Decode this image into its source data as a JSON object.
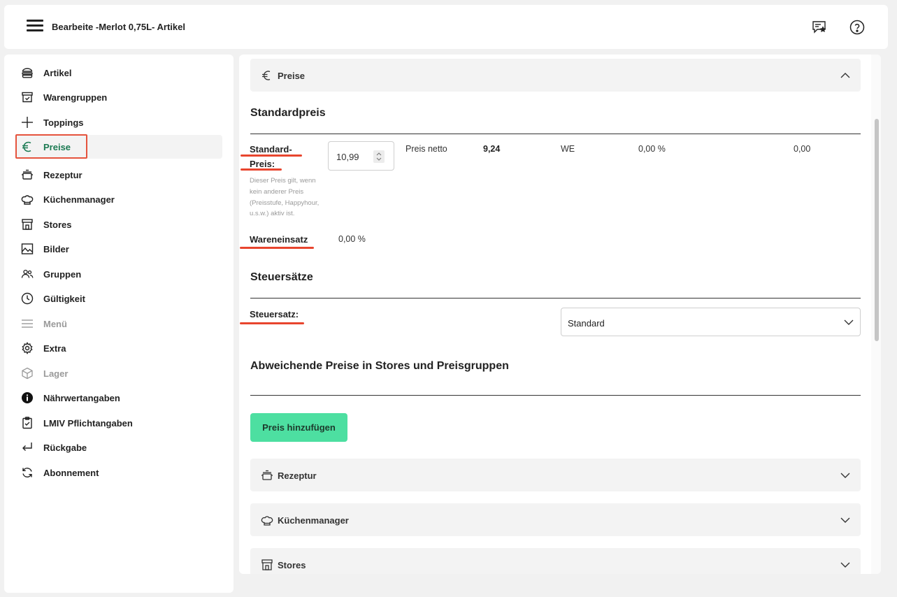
{
  "topbar": {
    "title": "Bearbeite -Merlot 0,75L- Artikel",
    "icons": [
      "menu-icon",
      "feedback-star-icon",
      "help-circle-icon"
    ]
  },
  "sidebar": {
    "items": [
      {
        "label": "Artikel",
        "icon": "burger-stack-icon"
      },
      {
        "label": "Warengruppen",
        "icon": "box-check-icon"
      },
      {
        "label": "Toppings",
        "icon": "plus-icon"
      },
      {
        "label": "Preise",
        "icon": "euro-icon",
        "active": true
      },
      {
        "label": "Rezeptur",
        "icon": "pot-icon"
      },
      {
        "label": "Küchenmanager",
        "icon": "chef-hat-icon"
      },
      {
        "label": "Stores",
        "icon": "store-icon"
      },
      {
        "label": "Bilder",
        "icon": "image-icon"
      },
      {
        "label": "Gruppen",
        "icon": "users-icon"
      },
      {
        "label": "Gültigkeit",
        "icon": "clock-icon"
      },
      {
        "label": "Menü",
        "icon": "list-icon",
        "disabled": true
      },
      {
        "label": "Extra",
        "icon": "gear-icon"
      },
      {
        "label": "Lager",
        "icon": "cube-icon",
        "disabled": true
      },
      {
        "label": "Nährwertangaben",
        "icon": "info-filled-icon"
      },
      {
        "label": "LMIV Pflichtangaben",
        "icon": "clipboard-check-icon"
      },
      {
        "label": "Rückgabe",
        "icon": "return-arrow-icon"
      },
      {
        "label": "Abonnement",
        "icon": "refresh-icon"
      }
    ]
  },
  "main": {
    "preise_section": {
      "label": "Preise"
    },
    "standardpreis": {
      "title": "Standardpreis",
      "label_line1": "Standard-",
      "label_line2": "Preis:",
      "hint": "Dieser Preis gilt, wenn kein anderer Preis (Preisstufe, Happyhour, u.s.w.) aktiv ist.",
      "value": "10,99",
      "preis_netto_label": "Preis netto",
      "preis_netto_value": "9,24",
      "we_label": "WE",
      "we_percent": "0,00 %",
      "we_value": "0,00",
      "wareneinsatz_label": "Wareneinsatz",
      "wareneinsatz_value": "0,00 %"
    },
    "steuersaetze": {
      "title": "Steuersätze",
      "label": "Steuersatz:",
      "selected": "Standard"
    },
    "abweichende": {
      "title": "Abweichende Preise in Stores und Preisgruppen",
      "add_button": "Preis hinzufügen"
    },
    "accordions": [
      {
        "label": "Rezeptur",
        "icon": "pot-icon"
      },
      {
        "label": "Küchenmanager",
        "icon": "chef-hat-icon"
      },
      {
        "label": "Stores",
        "icon": "store-icon"
      }
    ]
  },
  "colors": {
    "accent_green": "#4ddfa1",
    "active_text": "#1b7a52",
    "annotation_red": "#e8452e"
  }
}
